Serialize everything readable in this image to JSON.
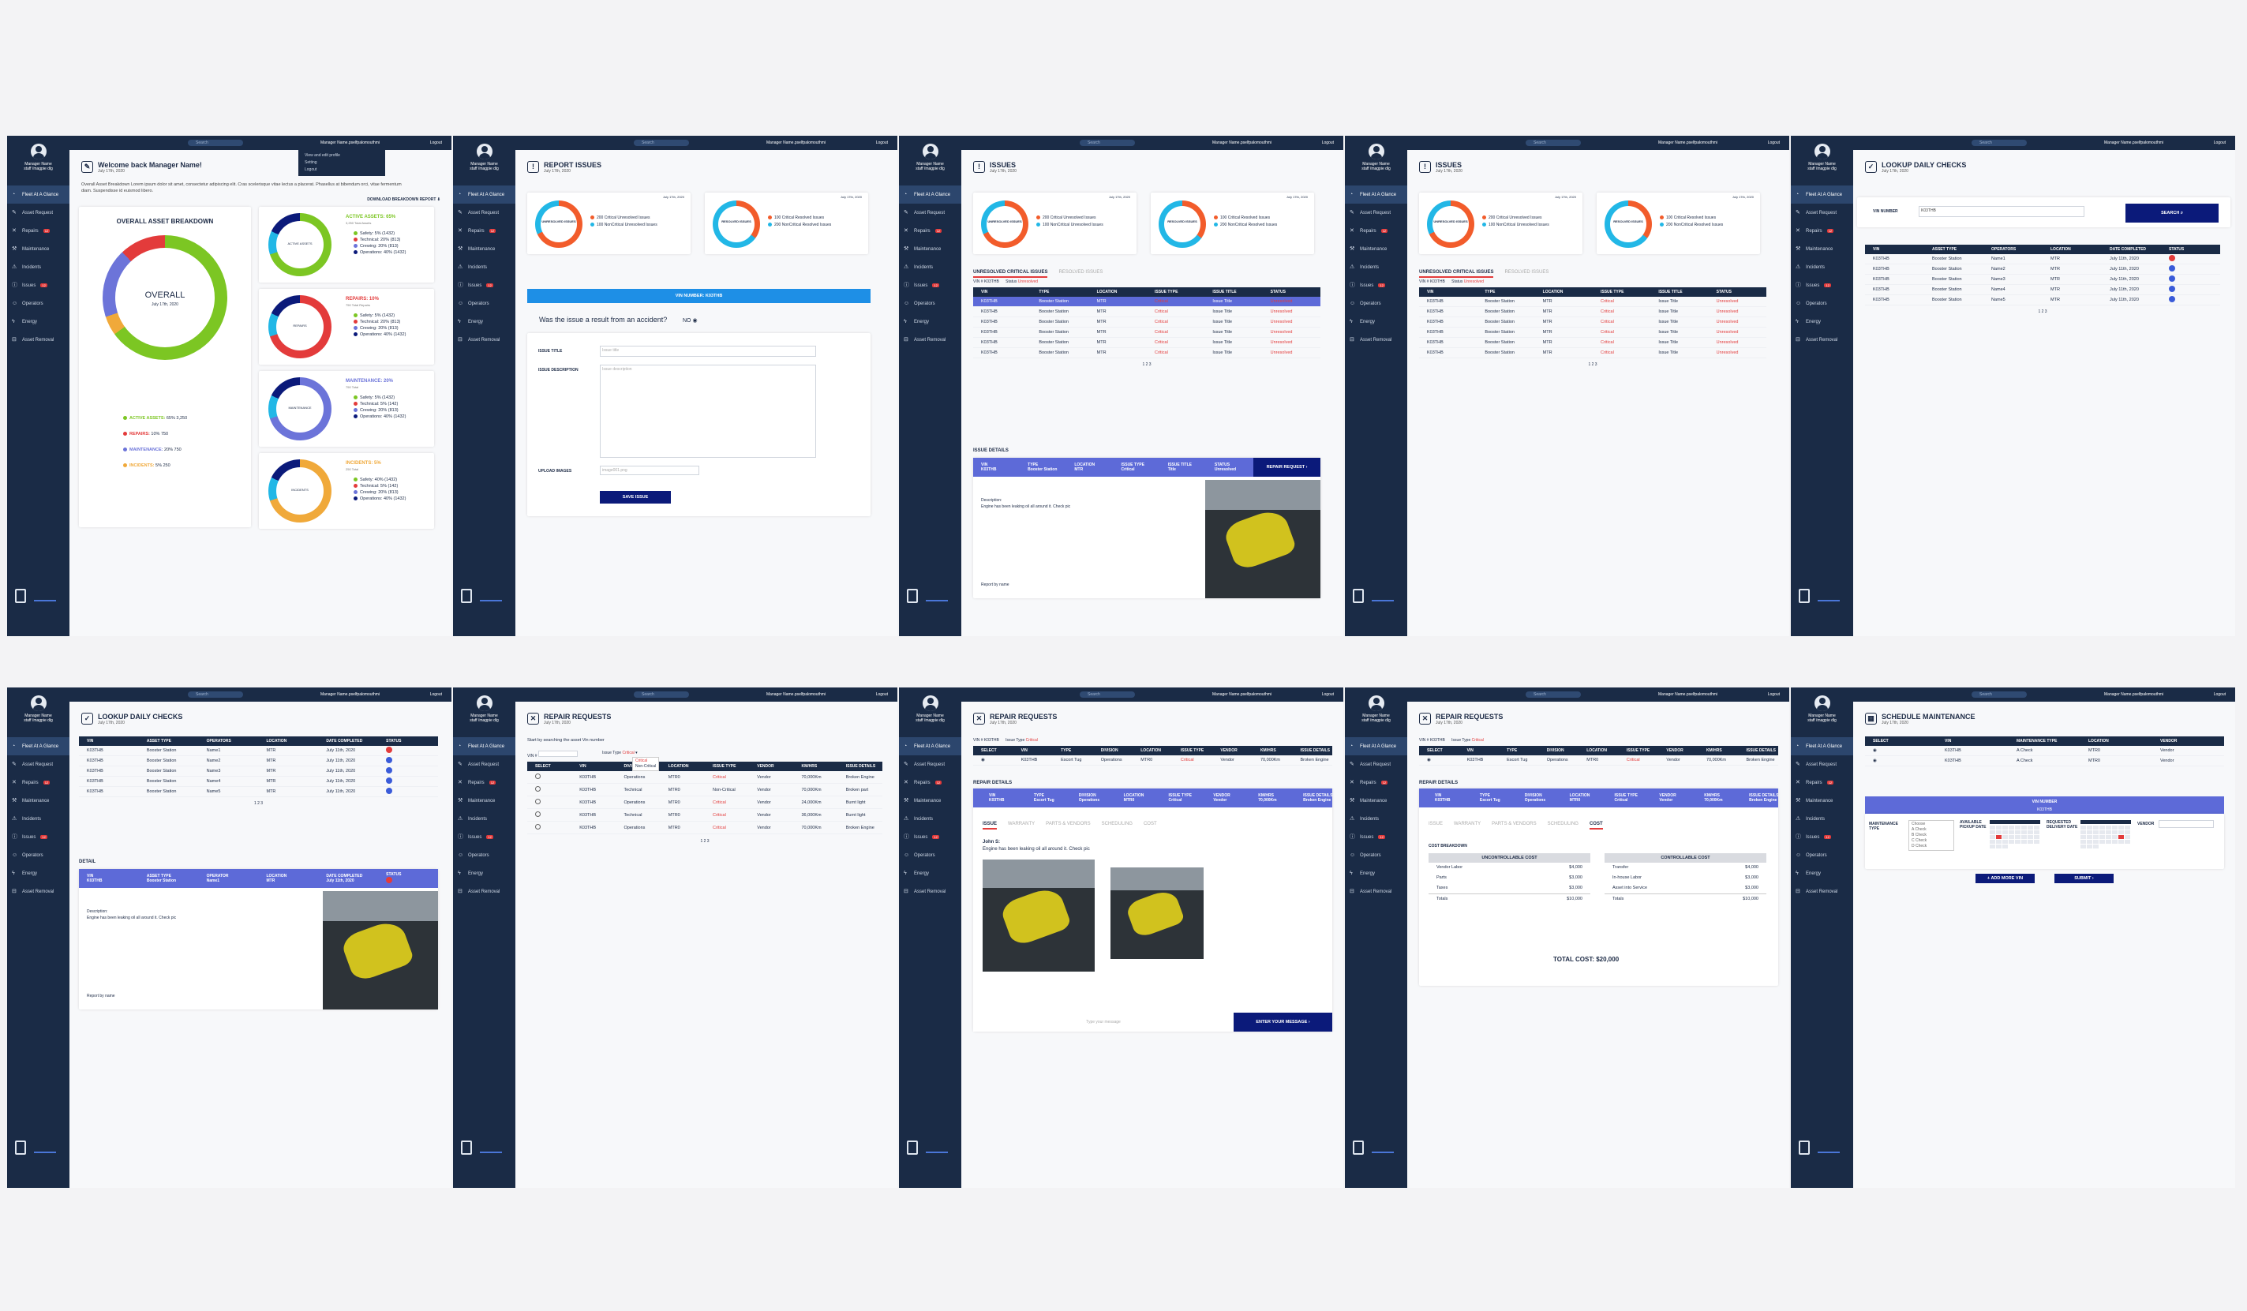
{
  "common": {
    "manager_name": "Manager Name",
    "manager_sub": "staff /magpie dlg",
    "search_placeholder": "Search",
    "user_email": "Manager Name.pselfpalomouthmi",
    "logout": "Logout",
    "date": "July 17th, 2020",
    "nav": [
      "Fleet At A Glance",
      "Asset Request",
      "Repairs",
      "Maintenance",
      "Incidents",
      "Issues",
      "Operators",
      "Energy",
      "Asset Removal"
    ],
    "badge": "12"
  },
  "p1": {
    "title": "Welcome back Manager Name!",
    "intro": "Overall Asset Breakdown Lorem ipsum dolor sit amet, consectetur adipiscing elit. Cras scelerisque vitae lectus a placerat. Phasellus at bibendum orci, vitae fermentum diam. Suspendisse id euismod libero.",
    "download": "DOWNLOAD BREAKDOWN REPORT",
    "dropdown": [
      "View and edit profile",
      "Setting",
      "Logout"
    ],
    "overall_title": "OVERALL ASSET BREAKDOWN",
    "overall_center": "OVERALL",
    "legend": [
      {
        "label": "ACTIVE ASSETS:",
        "value": "65% 3,250",
        "color": "#7cc623"
      },
      {
        "label": "REPAIRS:",
        "value": "10% 750",
        "color": "#e33b3b"
      },
      {
        "label": "MAINTENANCE:",
        "value": "20% 750",
        "color": "#6c74d9"
      },
      {
        "label": "INCIDENTS:",
        "value": "5% 250",
        "color": "#f0a93a"
      }
    ],
    "mini": [
      {
        "head": "ACTIVE ASSETS: 65%",
        "sub": "3,250 Total Assets",
        "center": "ACTIVE ASSETS",
        "color": "#7cc623",
        "items": [
          "Safety: 5% (1432)",
          "Technical: 20% (813)",
          "Crewing: 20% (813)",
          "Operations: 40% (1432)"
        ]
      },
      {
        "head": "REPAIRS: 10%",
        "sub": "750 Total Repairs",
        "center": "REPAIRS",
        "color": "#e33b3b",
        "items": [
          "Safety: 5% (1432)",
          "Technical: 20% (813)",
          "Crewing: 20% (813)",
          "Operations: 40% (1432)"
        ]
      },
      {
        "head": "MAINTENANCE: 20%",
        "sub": "750 Total",
        "center": "MAINTENANCE",
        "color": "#6c74d9",
        "items": [
          "Safety: 5% (1432)",
          "Technical: 5% (142)",
          "Crewing: 20% (813)",
          "Operations: 40% (1432)"
        ]
      },
      {
        "head": "INCIDENTS: 5%",
        "sub": "250 Total",
        "center": "INCIDENTS",
        "color": "#f0a93a",
        "items": [
          "Safety: 40% (1432)",
          "Technical: 5% (142)",
          "Crewing: 20% (813)",
          "Operations: 40% (1432)"
        ]
      }
    ]
  },
  "issues_summary": {
    "unresolved": "UNRESOLVED ISSUES",
    "resolved": "RESOLVED ISSUES",
    "u1": "200 Critical Unresolved Issues",
    "u2": "100 NonCritical Unresolved Issues",
    "r1": "100 Critical Resolved Issues",
    "r2": "200 NonCritical Resolved Issues"
  },
  "p2": {
    "title": "REPORT ISSUES",
    "vin_bar": "VIN NUMBER: K03THB",
    "question": "Was the issue a result from an accident?",
    "no": "NO",
    "issue_title": "ISSUE TITLE",
    "issue_desc": "ISSUE DESCRIPTION",
    "upload": "UPLOAD IMAGES",
    "title_ph": "Issue title",
    "desc_ph": "Issue description",
    "upload_ph": "image001.png",
    "save": "SAVE ISSUE"
  },
  "p3": {
    "title": "ISSUES",
    "tab_a": "UNRESOLVED CRITICAL ISSUES",
    "tab_b": "RESOLVED ISSUES",
    "vin_label": "VIN #",
    "vin_val": "K03THB",
    "status_label": "Status",
    "status_val": "Unresolved",
    "cols": [
      "VIN",
      "TYPE",
      "LOCATION",
      "ISSUE TYPE",
      "ISSUE TITLE",
      "STATUS"
    ],
    "rows": [
      [
        "K03THB",
        "Booster Station",
        "MTR",
        "Critical",
        "Issue Title",
        "Unresolved"
      ],
      [
        "K03THB",
        "Booster Station",
        "MTR",
        "Critical",
        "Issue Title",
        "Unresolved"
      ],
      [
        "K03THB",
        "Booster Station",
        "MTR",
        "Critical",
        "Issue Title",
        "Unresolved"
      ],
      [
        "K03THB",
        "Booster Station",
        "MTR",
        "Critical",
        "Issue Title",
        "Unresolved"
      ],
      [
        "K03THB",
        "Booster Station",
        "MTR",
        "Critical",
        "Issue Title",
        "Unresolved"
      ],
      [
        "K03THB",
        "Booster Station",
        "MTR",
        "Critical",
        "Issue Title",
        "Unresolved"
      ]
    ],
    "pager": "1 2 3",
    "details": "ISSUE DETAILS",
    "repair_req": "REPAIR REQUEST",
    "desc_label": "Description:",
    "desc": "Engine has been leaking oil all around it. Check pic",
    "report_by": "Report by name"
  },
  "p5": {
    "title": "LOOKUP DAILY CHECKS",
    "vin_label": "VIN NUMBER",
    "vin_val": "K03THB",
    "search": "SEARCH",
    "cols": [
      "VIN",
      "ASSET TYPE",
      "OPERATORS",
      "LOCATION",
      "DATE COMPLETED",
      "STATUS"
    ],
    "rows": [
      [
        "K03THB",
        "Booster Station",
        "Name1",
        "MTR",
        "July 11th, 2020"
      ],
      [
        "K03THB",
        "Booster Station",
        "Name2",
        "MTR",
        "July 11th, 2020"
      ],
      [
        "K03THB",
        "Booster Station",
        "Name3",
        "MTR",
        "July 11th, 2020"
      ],
      [
        "K03THB",
        "Booster Station",
        "Name4",
        "MTR",
        "July 11th, 2020"
      ],
      [
        "K03THB",
        "Booster Station",
        "Name5",
        "MTR",
        "July 11th, 2020"
      ]
    ],
    "pager": "1 2 3",
    "detail": "DETAIL"
  },
  "p7": {
    "title": "REPAIR REQUESTS",
    "intro": "Start by searching the asset Vin number",
    "issue_type": "Issue Type",
    "issue_type_val": "Critical",
    "dd": [
      "Critical",
      "Non-Critical"
    ],
    "cols": [
      "SELECT",
      "VIN",
      "DIVISION",
      "LOCATION",
      "ISSUE TYPE",
      "VENDOR",
      "KM/HRS",
      "ISSUE DETAILS"
    ],
    "rows": [
      [
        "K03THB",
        "Operations",
        "MTR0",
        "Critical",
        "Vendor",
        "70,000Km",
        "Broken Engine"
      ],
      [
        "K03THB",
        "Technical",
        "MTR0",
        "Non-Critical",
        "Vendor",
        "70,000Km",
        "Broken part"
      ],
      [
        "K03THB",
        "Operations",
        "MTR0",
        "Critical",
        "Vendor",
        "24,000Km",
        "Burnt light"
      ],
      [
        "K03THB",
        "Technical",
        "MTR0",
        "Critical",
        "Vendor",
        "36,000Km",
        "Burnt light"
      ],
      [
        "K03THB",
        "Operations",
        "MTR0",
        "Critical",
        "Vendor",
        "70,000Km",
        "Broken Engine"
      ]
    ],
    "pager": "1 2 3"
  },
  "p8": {
    "row": [
      "K03THB",
      "Escort Tug",
      "Operations",
      "MTR0",
      "Critical",
      "Vendor",
      "70,000Km",
      "Broken Engine"
    ],
    "cols": [
      "VIN",
      "TYPE",
      "DIVISION",
      "LOCATION",
      "ISSUE TYPE",
      "VENDOR",
      "KM/HRS",
      "ISSUE DETAILS"
    ],
    "details": "REPAIR DETAILS",
    "tabs": [
      "ISSUE",
      "WARRANTY",
      "PARTS & VENDORS",
      "SCHEDULING",
      "COST"
    ],
    "author": "John S:",
    "msg": "Engine has been leaking oil all around it. Check pic",
    "msg_ph": "Type your message",
    "send": "ENTER YOUR MESSAGE"
  },
  "p9": {
    "breakdown": "COST BREAKDOWN",
    "unc": "UNCONTROLLABLE COST",
    "con": "CONTROLLABLE COST",
    "unc_rows": [
      [
        "Vendor Labor",
        "$4,000"
      ],
      [
        "Parts",
        "$3,000"
      ],
      [
        "Taxes",
        "$3,000"
      ],
      [
        "Totals",
        "$10,000"
      ]
    ],
    "con_rows": [
      [
        "Transfer",
        "$4,000"
      ],
      [
        "In-house Labor",
        "$3,000"
      ],
      [
        "Asset into Service",
        "$3,000"
      ],
      [
        "Totals",
        "$10,000"
      ]
    ],
    "total_label": "TOTAL COST:",
    "total": "$20,000"
  },
  "p10": {
    "title": "SCHEDULE MAINTENANCE",
    "cols": [
      "SELECT",
      "VIN",
      "MAINTENANCE TYPE",
      "LOCATION",
      "VENDOR"
    ],
    "rows": [
      [
        "K03THB",
        "A Check",
        "MTR0",
        "Vendor"
      ],
      [
        "K03THB",
        "A Check",
        "MTR0",
        "Vendor"
      ]
    ],
    "vin_bar": "VIN NUMBER",
    "mt": "MAINTENANCE TYPE",
    "pickup": "AVAILABLE PICKUP DATE",
    "delivery": "REQUESTED DELIVERY DATE",
    "vendor": "VENDOR",
    "opts": [
      "Choose",
      "A Check",
      "B Check",
      "C Check",
      "D Check"
    ],
    "add": "ADD MORE VIN",
    "submit": "SUBMIT"
  }
}
